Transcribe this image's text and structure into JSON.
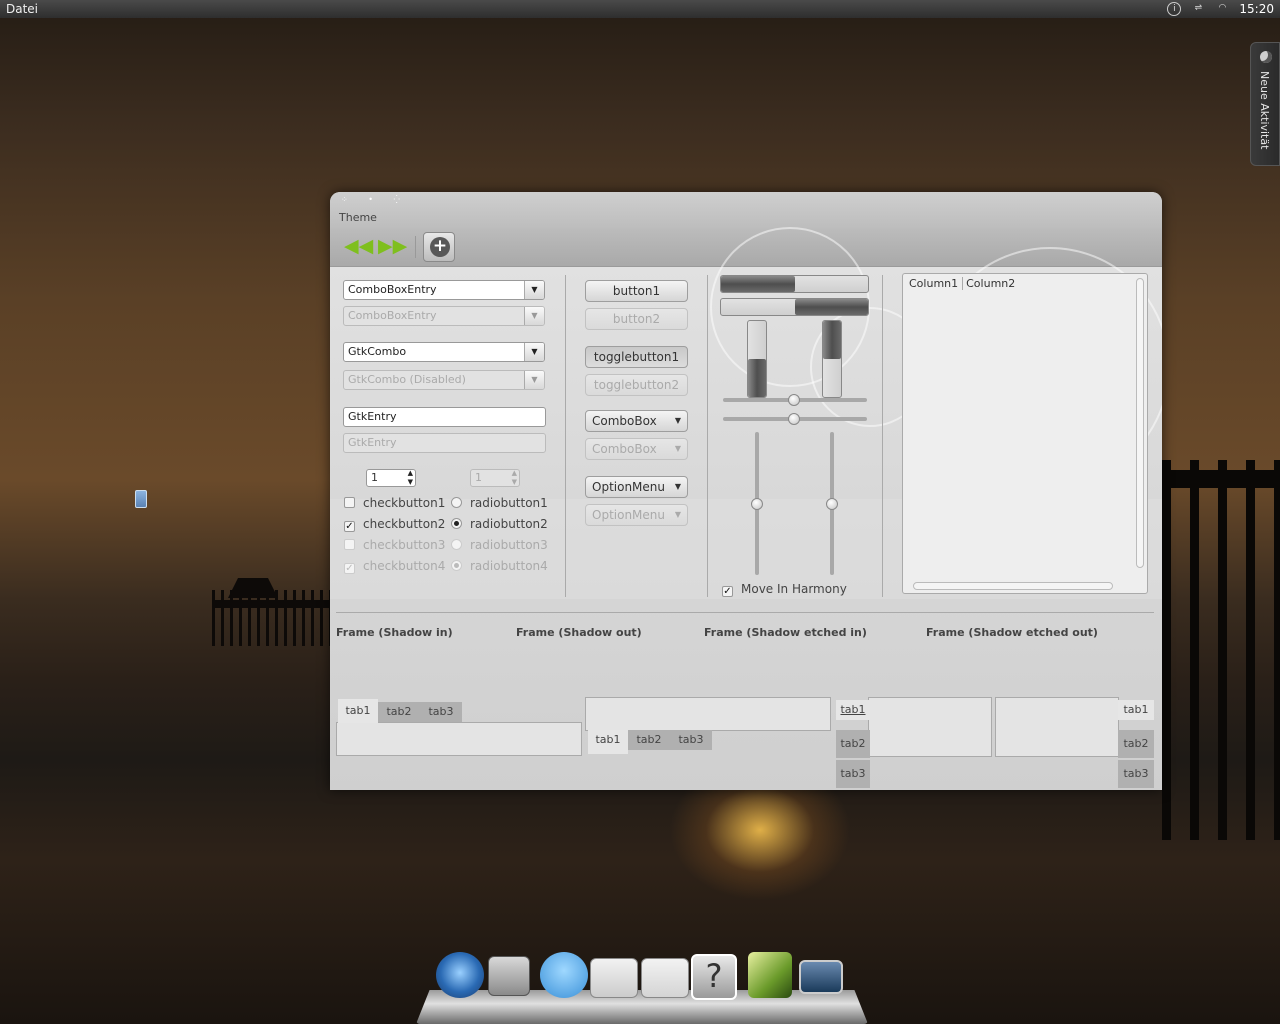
{
  "topbar": {
    "menu": "Datei",
    "clock": "15:20"
  },
  "activity": {
    "label": "Neue Aktivität"
  },
  "window": {
    "title": "Theme",
    "toolbar": {
      "back_icon": "double-arrow-left-icon",
      "forward_icon": "double-arrow-right-icon",
      "add_icon": "plus-circle-icon"
    },
    "left": {
      "combo_entry": "ComboBoxEntry",
      "combo_entry_disabled": "ComboBoxEntry",
      "gtk_combo": "GtkCombo",
      "gtk_combo_disabled": "GtkCombo (Disabled)",
      "gtk_entry": "GtkEntry",
      "gtk_entry_disabled": "GtkEntry",
      "spin1": "1",
      "spin2": "1",
      "checks": [
        {
          "label": "checkbutton1",
          "checked": false,
          "disabled": false
        },
        {
          "label": "checkbutton2",
          "checked": true,
          "disabled": false
        },
        {
          "label": "checkbutton3",
          "checked": false,
          "disabled": true
        },
        {
          "label": "checkbutton4",
          "checked": true,
          "disabled": true
        }
      ],
      "radios": [
        {
          "label": "radiobutton1",
          "checked": false,
          "disabled": false
        },
        {
          "label": "radiobutton2",
          "checked": true,
          "disabled": false
        },
        {
          "label": "radiobutton3",
          "checked": false,
          "disabled": true
        },
        {
          "label": "radiobutton4",
          "checked": true,
          "disabled": true
        }
      ]
    },
    "middle": {
      "button1": "button1",
      "button2": "button2",
      "toggle1": "togglebutton1",
      "toggle2": "togglebutton2",
      "combobox": "ComboBox",
      "combobox_disabled": "ComboBox",
      "optionmenu": "OptionMenu",
      "optionmenu_disabled": "OptionMenu"
    },
    "right": {
      "progress_h1": 0.5,
      "progress_h2": 0.5,
      "progress_v1": 0.5,
      "progress_v2": 0.5,
      "move_in_harmony": "Move In Harmony"
    },
    "tree": {
      "columns": [
        "Column1",
        "Column2"
      ]
    },
    "frames": [
      "Frame (Shadow in)",
      "Frame (Shadow out)",
      "Frame (Shadow etched in)",
      "Frame (Shadow etched out)"
    ],
    "tabs": [
      "tab1",
      "tab2",
      "tab3"
    ]
  },
  "dock": {
    "items": [
      "chromium-icon",
      "file-cabinet-icon",
      "chat-bubble-icon",
      "settings-tools-icon",
      "help-document-icon",
      "help-icon",
      "image-viewer-icon",
      "desktop-icon"
    ]
  }
}
